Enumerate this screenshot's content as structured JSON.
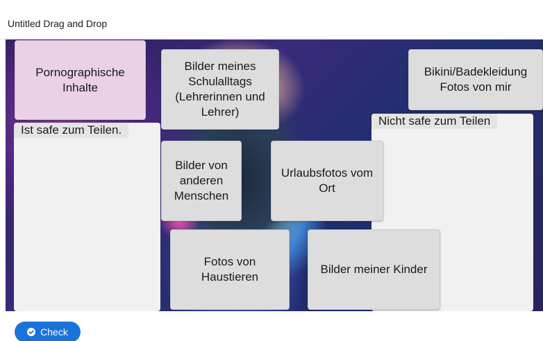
{
  "header": {
    "title": "Untitled Drag and Drop"
  },
  "dropzones": [
    {
      "label": "Ist safe zum Teilen."
    },
    {
      "label": "Nicht safe zum Teilen"
    }
  ],
  "draggables": [
    {
      "text": "Pornographische Inhalte"
    },
    {
      "text": "Bilder meines Schulalltags (Lehrerinnen und Lehrer)"
    },
    {
      "text": "Bikini/Badekleidung Fotos von mir"
    },
    {
      "text": "Bilder von anderen Menschen"
    },
    {
      "text": "Urlaubsfotos vom Ort"
    },
    {
      "text": "Fotos von Haustieren"
    },
    {
      "text": "Bilder meiner Kinder"
    }
  ],
  "footer": {
    "check_label": "Check",
    "check_icon": "check-circle-icon"
  },
  "colors": {
    "accent": "#1a73d9",
    "draggable": "#dddddd",
    "draggable_highlight": "#ead1e6",
    "dropzone": "#f1f1f1"
  }
}
